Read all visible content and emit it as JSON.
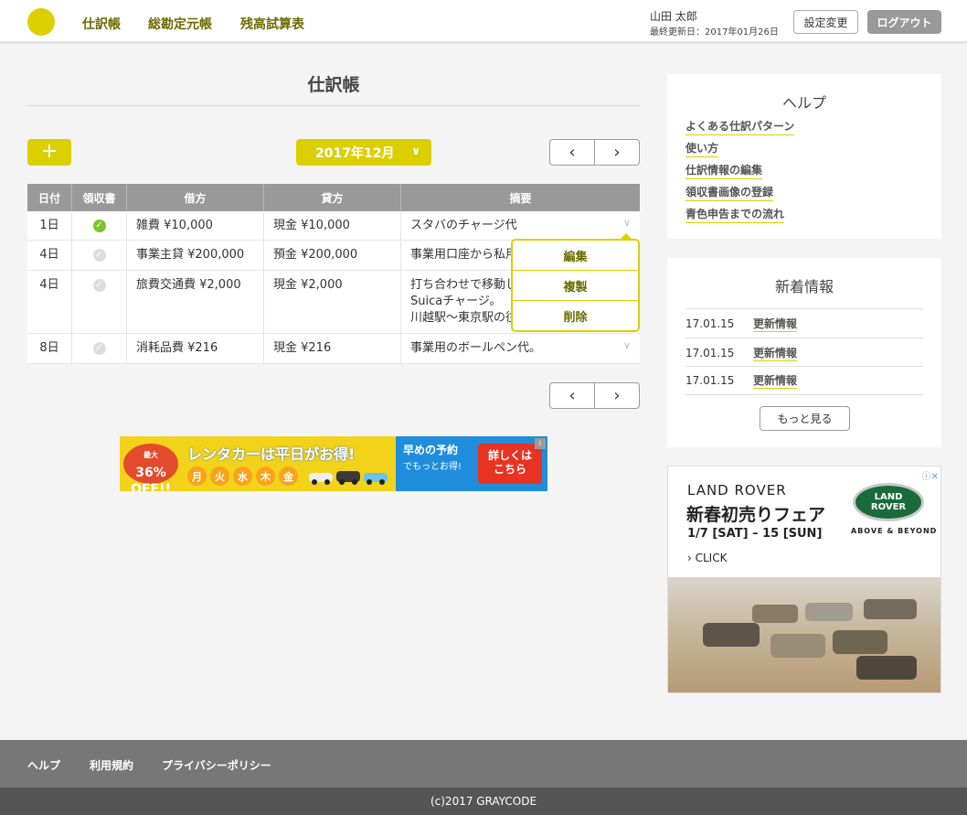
{
  "header": {
    "nav": [
      "仕訳帳",
      "総勘定元帳",
      "残高試算表"
    ],
    "user_name": "山田 太郎",
    "last_updated": "最終更新日：2017年01月26日",
    "settings_label": "設定変更",
    "logout_label": "ログアウト"
  },
  "main": {
    "title": "仕訳帳",
    "add_label": "+",
    "month": "2017年12月",
    "prev": "‹",
    "next": "›",
    "columns": [
      "日付",
      "領収書",
      "借方",
      "貸方",
      "摘要"
    ],
    "rows": [
      {
        "date": "1日",
        "receipt": true,
        "debit": "雑費 ¥10,000",
        "credit": "現金 ¥10,000",
        "memo": "スタバのチャージ代"
      },
      {
        "date": "4日",
        "receipt": false,
        "debit": "事業主貸 ¥200,000",
        "credit": "預金 ¥200,000",
        "memo": "事業用口座から私用"
      },
      {
        "date": "4日",
        "receipt": false,
        "debit": "旅費交通費 ¥2,000",
        "credit": "現金 ¥2,000",
        "memo": "打ち合わせで移動し\nSuicaチャージ。\n川越駅〜東京駅の往"
      },
      {
        "date": "8日",
        "receipt": false,
        "debit": "消耗品費 ¥216",
        "credit": "現金 ¥216",
        "memo": "事業用のボールペン代。"
      }
    ],
    "row_menu": [
      "編集",
      "複製",
      "削除"
    ]
  },
  "ad_banner": {
    "badge_small": "最大",
    "badge": "36%\nOFF!!",
    "title": "レンタカーは平日がお得!",
    "days": [
      "月",
      "火",
      "水",
      "木",
      "金"
    ],
    "promo1": "早めの予約",
    "promo2": "でもっとお得!",
    "cta": "詳しくは\nこちら",
    "info": "i"
  },
  "sidebar": {
    "help_title": "ヘルプ",
    "help_links": [
      "よくある仕訳パターン",
      "使い方",
      "仕訳情報の編集",
      "領収書画像の登録",
      "青色申告までの流れ"
    ],
    "news_title": "新着情報",
    "news": [
      {
        "date": "17.01.15",
        "label": "更新情報"
      },
      {
        "date": "17.01.15",
        "label": "更新情報"
      },
      {
        "date": "17.01.15",
        "label": "更新情報"
      }
    ],
    "more_label": "もっと見る"
  },
  "ad_side": {
    "brand": "LAND ROVER",
    "headline": "新春初売りフェア",
    "dates": "1/7 [SAT] – 15 [SUN]",
    "click": "› CLICK",
    "logo": "LAND\nROVER",
    "tagline": "ABOVE & BEYOND",
    "adinfo": "ⓘ✕"
  },
  "footer": {
    "links": [
      "ヘルプ",
      "利用規約",
      "プライバシーポリシー"
    ],
    "copyright": "(c)2017 GRAYCODE"
  }
}
